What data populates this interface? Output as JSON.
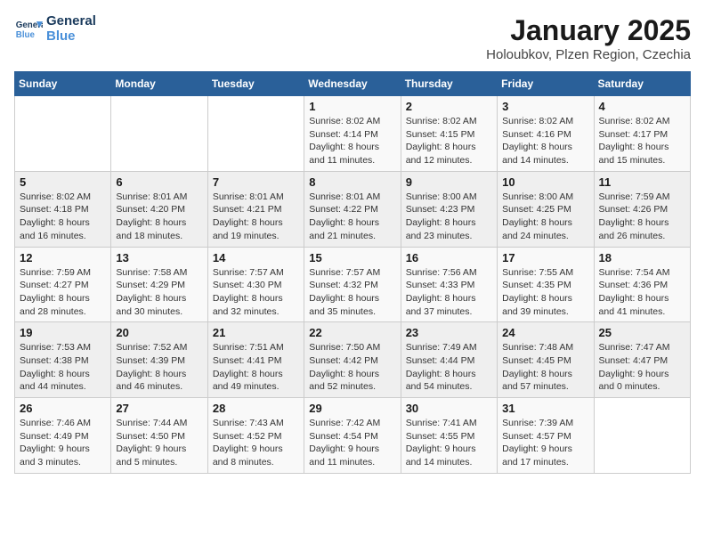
{
  "logo": {
    "line1": "General",
    "line2": "Blue"
  },
  "title": "January 2025",
  "subtitle": "Holoubkov, Plzen Region, Czechia",
  "weekdays": [
    "Sunday",
    "Monday",
    "Tuesday",
    "Wednesday",
    "Thursday",
    "Friday",
    "Saturday"
  ],
  "weeks": [
    [
      {
        "day": "",
        "info": ""
      },
      {
        "day": "",
        "info": ""
      },
      {
        "day": "",
        "info": ""
      },
      {
        "day": "1",
        "info": "Sunrise: 8:02 AM\nSunset: 4:14 PM\nDaylight: 8 hours and 11 minutes."
      },
      {
        "day": "2",
        "info": "Sunrise: 8:02 AM\nSunset: 4:15 PM\nDaylight: 8 hours and 12 minutes."
      },
      {
        "day": "3",
        "info": "Sunrise: 8:02 AM\nSunset: 4:16 PM\nDaylight: 8 hours and 14 minutes."
      },
      {
        "day": "4",
        "info": "Sunrise: 8:02 AM\nSunset: 4:17 PM\nDaylight: 8 hours and 15 minutes."
      }
    ],
    [
      {
        "day": "5",
        "info": "Sunrise: 8:02 AM\nSunset: 4:18 PM\nDaylight: 8 hours and 16 minutes."
      },
      {
        "day": "6",
        "info": "Sunrise: 8:01 AM\nSunset: 4:20 PM\nDaylight: 8 hours and 18 minutes."
      },
      {
        "day": "7",
        "info": "Sunrise: 8:01 AM\nSunset: 4:21 PM\nDaylight: 8 hours and 19 minutes."
      },
      {
        "day": "8",
        "info": "Sunrise: 8:01 AM\nSunset: 4:22 PM\nDaylight: 8 hours and 21 minutes."
      },
      {
        "day": "9",
        "info": "Sunrise: 8:00 AM\nSunset: 4:23 PM\nDaylight: 8 hours and 23 minutes."
      },
      {
        "day": "10",
        "info": "Sunrise: 8:00 AM\nSunset: 4:25 PM\nDaylight: 8 hours and 24 minutes."
      },
      {
        "day": "11",
        "info": "Sunrise: 7:59 AM\nSunset: 4:26 PM\nDaylight: 8 hours and 26 minutes."
      }
    ],
    [
      {
        "day": "12",
        "info": "Sunrise: 7:59 AM\nSunset: 4:27 PM\nDaylight: 8 hours and 28 minutes."
      },
      {
        "day": "13",
        "info": "Sunrise: 7:58 AM\nSunset: 4:29 PM\nDaylight: 8 hours and 30 minutes."
      },
      {
        "day": "14",
        "info": "Sunrise: 7:57 AM\nSunset: 4:30 PM\nDaylight: 8 hours and 32 minutes."
      },
      {
        "day": "15",
        "info": "Sunrise: 7:57 AM\nSunset: 4:32 PM\nDaylight: 8 hours and 35 minutes."
      },
      {
        "day": "16",
        "info": "Sunrise: 7:56 AM\nSunset: 4:33 PM\nDaylight: 8 hours and 37 minutes."
      },
      {
        "day": "17",
        "info": "Sunrise: 7:55 AM\nSunset: 4:35 PM\nDaylight: 8 hours and 39 minutes."
      },
      {
        "day": "18",
        "info": "Sunrise: 7:54 AM\nSunset: 4:36 PM\nDaylight: 8 hours and 41 minutes."
      }
    ],
    [
      {
        "day": "19",
        "info": "Sunrise: 7:53 AM\nSunset: 4:38 PM\nDaylight: 8 hours and 44 minutes."
      },
      {
        "day": "20",
        "info": "Sunrise: 7:52 AM\nSunset: 4:39 PM\nDaylight: 8 hours and 46 minutes."
      },
      {
        "day": "21",
        "info": "Sunrise: 7:51 AM\nSunset: 4:41 PM\nDaylight: 8 hours and 49 minutes."
      },
      {
        "day": "22",
        "info": "Sunrise: 7:50 AM\nSunset: 4:42 PM\nDaylight: 8 hours and 52 minutes."
      },
      {
        "day": "23",
        "info": "Sunrise: 7:49 AM\nSunset: 4:44 PM\nDaylight: 8 hours and 54 minutes."
      },
      {
        "day": "24",
        "info": "Sunrise: 7:48 AM\nSunset: 4:45 PM\nDaylight: 8 hours and 57 minutes."
      },
      {
        "day": "25",
        "info": "Sunrise: 7:47 AM\nSunset: 4:47 PM\nDaylight: 9 hours and 0 minutes."
      }
    ],
    [
      {
        "day": "26",
        "info": "Sunrise: 7:46 AM\nSunset: 4:49 PM\nDaylight: 9 hours and 3 minutes."
      },
      {
        "day": "27",
        "info": "Sunrise: 7:44 AM\nSunset: 4:50 PM\nDaylight: 9 hours and 5 minutes."
      },
      {
        "day": "28",
        "info": "Sunrise: 7:43 AM\nSunset: 4:52 PM\nDaylight: 9 hours and 8 minutes."
      },
      {
        "day": "29",
        "info": "Sunrise: 7:42 AM\nSunset: 4:54 PM\nDaylight: 9 hours and 11 minutes."
      },
      {
        "day": "30",
        "info": "Sunrise: 7:41 AM\nSunset: 4:55 PM\nDaylight: 9 hours and 14 minutes."
      },
      {
        "day": "31",
        "info": "Sunrise: 7:39 AM\nSunset: 4:57 PM\nDaylight: 9 hours and 17 minutes."
      },
      {
        "day": "",
        "info": ""
      }
    ]
  ]
}
